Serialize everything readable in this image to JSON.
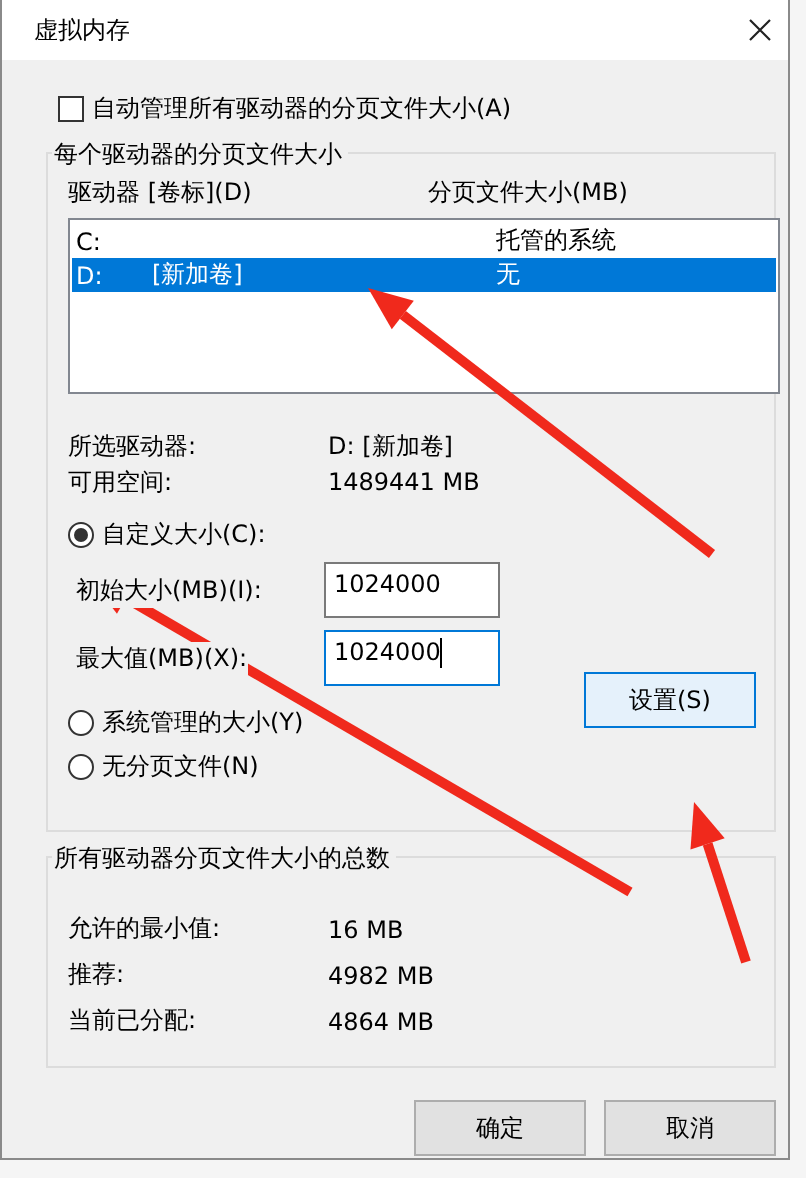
{
  "window": {
    "title": "虚拟内存"
  },
  "auto_manage": {
    "label": "自动管理所有驱动器的分页文件大小(A)",
    "checked": false
  },
  "per_drive": {
    "title": "每个驱动器的分页文件大小",
    "columns": [
      "驱动器 [卷标](D)",
      "分页文件大小(MB)"
    ],
    "rows": [
      {
        "drive": "C:",
        "size": "托管的系统",
        "selected": false
      },
      {
        "drive": "D:",
        "volume": "[新加卷]",
        "size": "无",
        "selected": true
      }
    ],
    "info": [
      {
        "label": "所选驱动器:",
        "value": "D:  [新加卷]"
      },
      {
        "label": "可用空间:",
        "value": "1489441 MB"
      }
    ],
    "options": [
      {
        "label": "自定义大小(C):",
        "selected": true
      },
      {
        "label": "系统管理的大小(Y)",
        "selected": false
      },
      {
        "label": "无分页文件(N)",
        "selected": false
      }
    ],
    "fields": [
      {
        "label": "初始大小(MB)(I):",
        "value": "1024000",
        "focused": false
      },
      {
        "label": "最大值(MB)(X):",
        "value": "1024000",
        "focused": true
      }
    ],
    "set_button": "设置(S)"
  },
  "totals": {
    "title": "所有驱动器分页文件大小的总数",
    "rows": [
      {
        "label": "允许的最小值:",
        "value": "16 MB"
      },
      {
        "label": "推荐:",
        "value": "4982 MB"
      },
      {
        "label": "当前已分配:",
        "value": "4864 MB"
      }
    ]
  },
  "buttons": [
    "确定",
    "取消"
  ]
}
